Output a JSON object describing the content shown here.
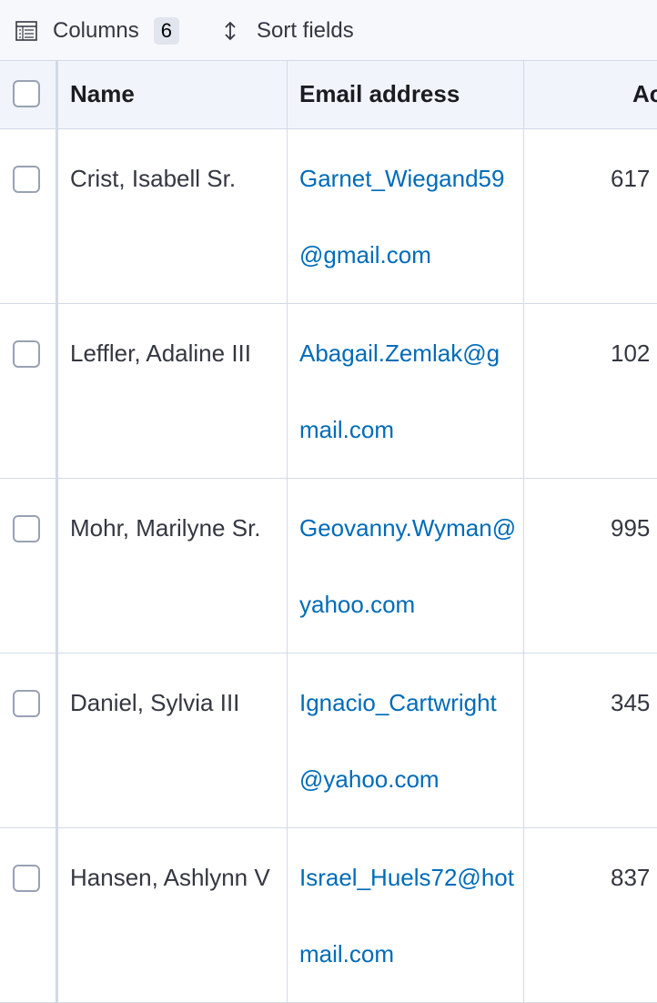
{
  "toolbar": {
    "columns_label": "Columns",
    "columns_count": "6",
    "sort_label": "Sort fields"
  },
  "table": {
    "headers": {
      "name": "Name",
      "email": "Email address",
      "account": "Ac"
    },
    "rows": [
      {
        "name": "Crist, Isabell Sr.",
        "email": "Garnet_Wiegand59@gmail.com",
        "account": "617"
      },
      {
        "name": "Leffler, Adaline III",
        "email": "Abagail.Zemlak@gmail.com",
        "account": "102"
      },
      {
        "name": "Mohr, Marilyne Sr.",
        "email": "Geovanny.Wyman@yahoo.com",
        "account": "995"
      },
      {
        "name": "Daniel, Sylvia III",
        "email": "Ignacio_Cartwright@yahoo.com",
        "account": "345"
      },
      {
        "name": "Hansen, Ashlynn V",
        "email": "Israel_Huels72@hotmail.com",
        "account": "837"
      }
    ]
  },
  "colors": {
    "link": "#006bb8",
    "header_bg": "#f1f4fa",
    "toolbar_bg": "#f7f8fc",
    "border": "#d3dae6"
  }
}
